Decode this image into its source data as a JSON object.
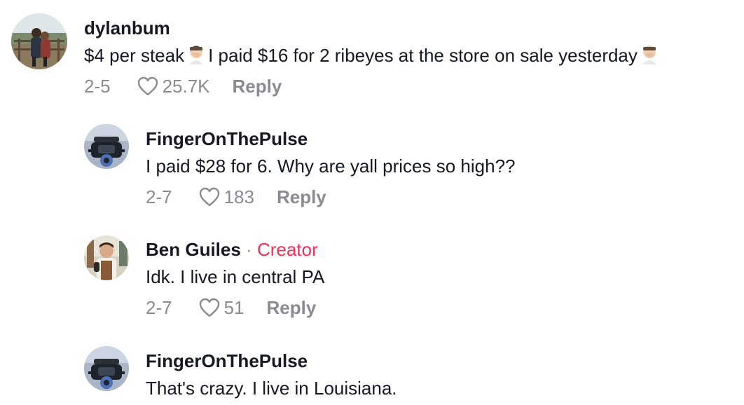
{
  "comments": [
    {
      "username": "dylanbum",
      "text_before_emoji": "$4 per steak",
      "text_mid": "I paid $16 for 2 ribeyes at the store on sale yesterday",
      "date": "2-5",
      "likes": "25.7K",
      "reply_label": "Reply",
      "emoji": "facepalm-emoji"
    },
    {
      "username": "FingerOnThePulse",
      "text": "I paid $28 for 6. Why are yall prices so high??",
      "date": "2-7",
      "likes": "183",
      "reply_label": "Reply"
    },
    {
      "username": "Ben Guiles",
      "separator": " · ",
      "creator_label": "Creator",
      "text": "Idk. I live in central PA",
      "date": "2-7",
      "likes": "51",
      "reply_label": "Reply"
    },
    {
      "username": "FingerOnThePulse",
      "text": "That's crazy. I live in Louisiana."
    }
  ],
  "colors": {
    "text": "#161823",
    "muted": "#8a8b91",
    "creator": "#fe2c55"
  }
}
